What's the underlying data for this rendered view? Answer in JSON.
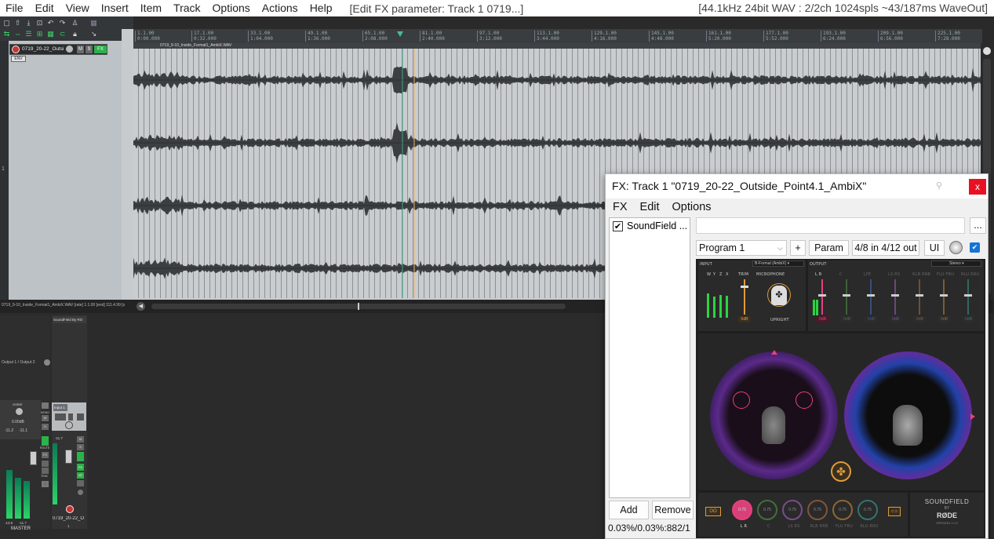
{
  "menubar": {
    "items": [
      "File",
      "Edit",
      "View",
      "Insert",
      "Item",
      "Track",
      "Options",
      "Actions",
      "Help"
    ],
    "window_title": "[Edit FX parameter: Track 1 0719...]",
    "audio_status": "[44.1kHz 24bit WAV : 2/2ch 1024spls ~43/187ms WaveOut]"
  },
  "track": {
    "name": "0719_20-22_Outsi",
    "track_number": "1",
    "env_button": "ENV",
    "mute": "M",
    "solo": "S",
    "fx": "FX"
  },
  "ruler": {
    "ticks": [
      "1.1.00",
      "17.1.00",
      "33.1.00",
      "49.1.00",
      "65.1.00",
      "81.1.00",
      "97.1.00",
      "113.1.00",
      "129.1.00",
      "145.1.00",
      "161.1.00",
      "177.1.00",
      "193.1.00",
      "209.1.00",
      "225.1.00"
    ],
    "times": [
      "0:00.000",
      "0:32.000",
      "1:04.000",
      "1:36.000",
      "2:08.000",
      "2:40.000",
      "3:12.000",
      "3:44.000",
      "4:16.000",
      "4:48.000",
      "5:20.000",
      "5:52.000",
      "6:24.000",
      "6:56.000",
      "7:28.000"
    ]
  },
  "item": {
    "name": "0719_9-10_Inside_Format1_AmbiX.WAV"
  },
  "statusline": "0719_9-10_Inside_Format1_AmbiX.WAV [rate] 1.1.00 [end] 111.4.99 [s",
  "mixer": {
    "fx_slot": "SoundField By RO",
    "master_io": "Output 1 / Output 2",
    "master_label": "MASTER",
    "master_db": "0.00dB",
    "master_peaks": [
      "-11.2",
      "-11.1"
    ],
    "master_bottom_peaks": [
      "-13.5",
      "-11.7"
    ],
    "track_input": "Input 1",
    "track_label": "0719_20-22_O",
    "track_peak": "-11.7",
    "buttons": {
      "mono": "MONO",
      "route": "ROUTE",
      "fx": "FX",
      "trim": "TRIM",
      "io": "IO",
      "m": "M",
      "s": "S"
    },
    "center": "center",
    "track_num": "1"
  },
  "fx_window": {
    "title": "FX: Track 1 \"0719_20-22_Outside_Point4.1_AmbiX\"",
    "menu": [
      "FX",
      "Edit",
      "Options"
    ],
    "fx_list": [
      {
        "name": "SoundField ...",
        "enabled": true
      }
    ],
    "add": "Add",
    "remove": "Remove",
    "cpu": "0.03%/0.03%:882/1",
    "preset_more": "...",
    "preset": "Program 1",
    "plus": "+",
    "param": "Param",
    "io": "4/8 in 4/12 out",
    "ui": "UI",
    "close": "x"
  },
  "plugin": {
    "input_label": "INPUT",
    "input_format": "B-Format (AmbiX)",
    "output_label": "OUTPUT",
    "output_format": "Stereo",
    "input_channels": [
      "W",
      "Y",
      "Z",
      "X"
    ],
    "trim_label": "TRIM",
    "trim_value": "0dB",
    "mic_label": "MICROPHONE",
    "mic_orientation": "UPRIGHT",
    "output_channels": [
      {
        "name": "L R",
        "value": "0dB",
        "color": "#e8407a"
      },
      {
        "name": "C",
        "value": "0dB",
        "color": "#54a84c"
      },
      {
        "name": "LFE",
        "value": "0dB",
        "color": "#4a7fd8"
      },
      {
        "name": "LS RS",
        "value": "0dB",
        "color": "#b86adb"
      },
      {
        "name": "RLB RRB",
        "value": "0dB",
        "color": "#c87a4a"
      },
      {
        "name": "FLU FRU",
        "value": "0dB",
        "color": "#e09a3a"
      },
      {
        "name": "RLU RRU",
        "value": "0dB",
        "color": "#3ab0a8"
      }
    ],
    "knobs": [
      {
        "label": "L R",
        "value": "0.75",
        "color": "#e8407a"
      },
      {
        "label": "C",
        "value": "0.75",
        "color": "#54a84c"
      },
      {
        "label": "LS RS",
        "value": "0.75",
        "color": "#b86adb"
      },
      {
        "label": "RLB RRB",
        "value": "0.75",
        "color": "#c87a4a"
      },
      {
        "label": "FLU FRU",
        "value": "0.75",
        "color": "#e09a3a"
      },
      {
        "label": "RLU RRU",
        "value": "0.75",
        "color": "#3ab0a8"
      }
    ],
    "brand": "SOUNDFIELD",
    "brand_by": "BY",
    "brand_maker": "RØDE",
    "version": "VERSION 1.0.2",
    "oo": "OO"
  }
}
